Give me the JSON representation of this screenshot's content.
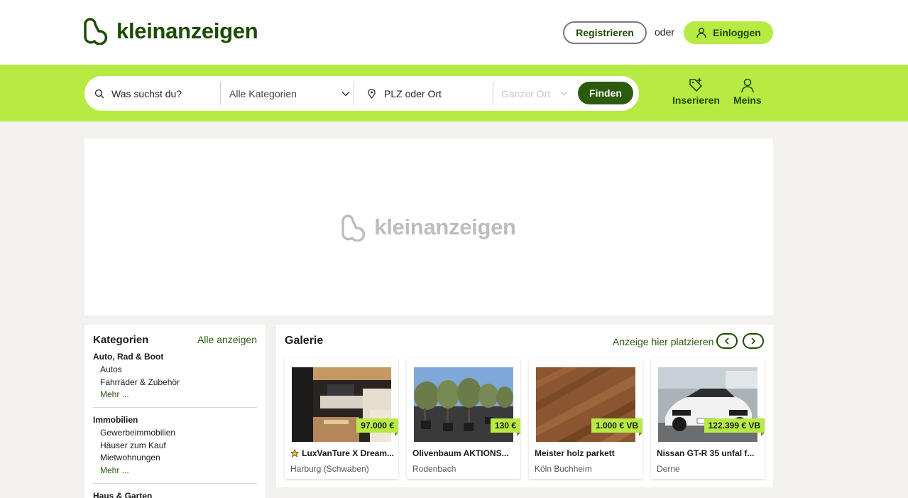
{
  "header": {
    "logo_text": "kleinanzeigen",
    "register_label": "Registrieren",
    "or_text": "oder",
    "login_label": "Einloggen"
  },
  "search": {
    "query_placeholder": "Was suchst du?",
    "category_value": "Alle Kategorien",
    "location_placeholder": "PLZ oder Ort",
    "radius_value": "Ganzer Ort",
    "find_label": "Finden"
  },
  "nav": {
    "post_label": "Inserieren",
    "mine_label": "Meins"
  },
  "banner": {
    "logo_text": "kleinanzeigen"
  },
  "categories": {
    "title": "Kategorien",
    "all_label": "Alle anzeigen",
    "groups": [
      {
        "name": "Auto, Rad & Boot",
        "items": [
          "Autos",
          "Fahrräder & Zubehör"
        ],
        "more": "Mehr ..."
      },
      {
        "name": "Immobilien",
        "items": [
          "Gewerbeimmobilien",
          "Häuser zum Kauf",
          "Mietwohnungen"
        ],
        "more": "Mehr ..."
      },
      {
        "name": "Haus & Garten",
        "items": [],
        "more": ""
      }
    ]
  },
  "gallery": {
    "title": "Galerie",
    "place_ad_label": "Anzeige hier platzieren",
    "cards": [
      {
        "title": "LuxVanTure X Dream...",
        "price": "97.000 €",
        "location": "Harburg (Schwaben)",
        "featured": true
      },
      {
        "title": "Olivenbaum AKTIONS...",
        "price": "130 €",
        "location": "Rodenbach",
        "featured": false
      },
      {
        "title": "Meister holz parkett",
        "price": "1.000 € VB",
        "location": "Köln Buchheim",
        "featured": false
      },
      {
        "title": "Nissan GT-R 35 unfal f...",
        "price": "122.399 € VB",
        "location": "Derne",
        "featured": false
      }
    ]
  },
  "colors": {
    "brand_green": "#b7ea43",
    "dark_green": "#1d4b00",
    "button_green": "#2c5b0d"
  }
}
